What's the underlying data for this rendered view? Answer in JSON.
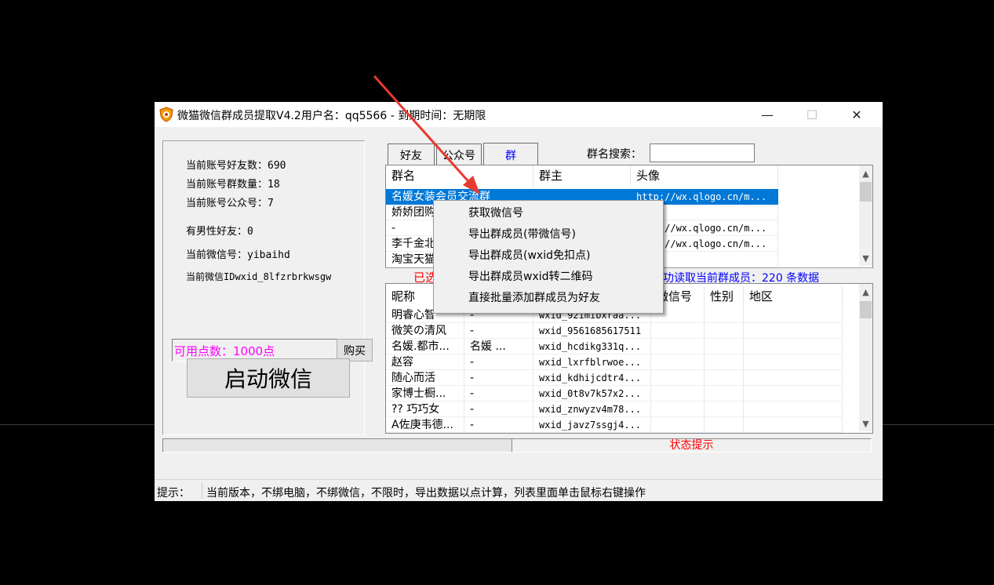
{
  "title": "微猫微信群成员提取V4.2用户名：qq5566 - 到期时间：无期限",
  "window_controls": {
    "minimize": "—",
    "maximize": "☐",
    "close": "✕"
  },
  "account": {
    "friends_count": "当前账号好友数：690",
    "groups_count": "当前账号群数量：18",
    "official_count": "当前账号公众号：7",
    "male_friends": "有男性好友：0",
    "wechat_id": "当前微信号：yibaihd",
    "wxid": "当前微信IDwxid_8lfzrbrkwsgw"
  },
  "points": {
    "label": "可用点数：1000点",
    "buy_button": "购买"
  },
  "launch_button": "启动微信",
  "tabs": [
    "好友",
    "公众号",
    "群"
  ],
  "group_search": {
    "label": "群名搜索：",
    "value": ""
  },
  "groups_table": {
    "headers": [
      "群名",
      "群主",
      "头像"
    ],
    "rows": [
      [
        "名媛女装会员交流群",
        "",
        "http://wx.qlogo.cn/m..."
      ],
      [
        "娇娇团购",
        "",
        ""
      ],
      [
        "-",
        "",
        "http://wx.qlogo.cn/m..."
      ],
      [
        "李千金北京",
        "",
        "http://wx.qlogo.cn/m..."
      ],
      [
        "淘宝天猫",
        "",
        ""
      ]
    ]
  },
  "status_line": {
    "left": "已选",
    "right": "功读取当前群成员：220 条数据"
  },
  "members_table": {
    "headers": [
      "昵称",
      "",
      "",
      "微信号",
      "性别",
      "地区"
    ],
    "rows": [
      [
        "明睿心智",
        "-",
        "wxid_92imibxraa..."
      ],
      [
        "微笑の清风",
        "-",
        "wxid_9561685617511"
      ],
      [
        "名媛.都市...",
        "名媛 ...",
        "wxid_hcdikg331q..."
      ],
      [
        "赵容",
        "-",
        "wxid_lxrfblrwoe..."
      ],
      [
        "随心而活",
        "-",
        "wxid_kdhijcdtr4..."
      ],
      [
        "家博士橱...",
        "-",
        "wxid_0t8v7k57x2..."
      ],
      [
        "?? 巧巧女",
        "-",
        "wxid_znwyzv4m78..."
      ],
      [
        "A佐庚韦德...",
        "-",
        "wxid_javz7ssgj4..."
      ]
    ]
  },
  "status_hint": "状态提示",
  "statusbar": {
    "label": "提示：",
    "text": "当前版本，不绑电脑，不绑微信，不限时，导出数据以点计算，列表里面单击鼠标右键操作"
  },
  "context_menu": [
    "获取微信号",
    "导出群成员(带微信号)",
    "导出群成员(wxid免扣点)",
    "导出群成员wxid转二维码",
    "直接批量添加群成员为好友"
  ],
  "colors": {
    "selection": "#0078d7",
    "accent_text": "#ff0000",
    "points_text": "#ff00ff",
    "arrow": "#e83a2e"
  }
}
